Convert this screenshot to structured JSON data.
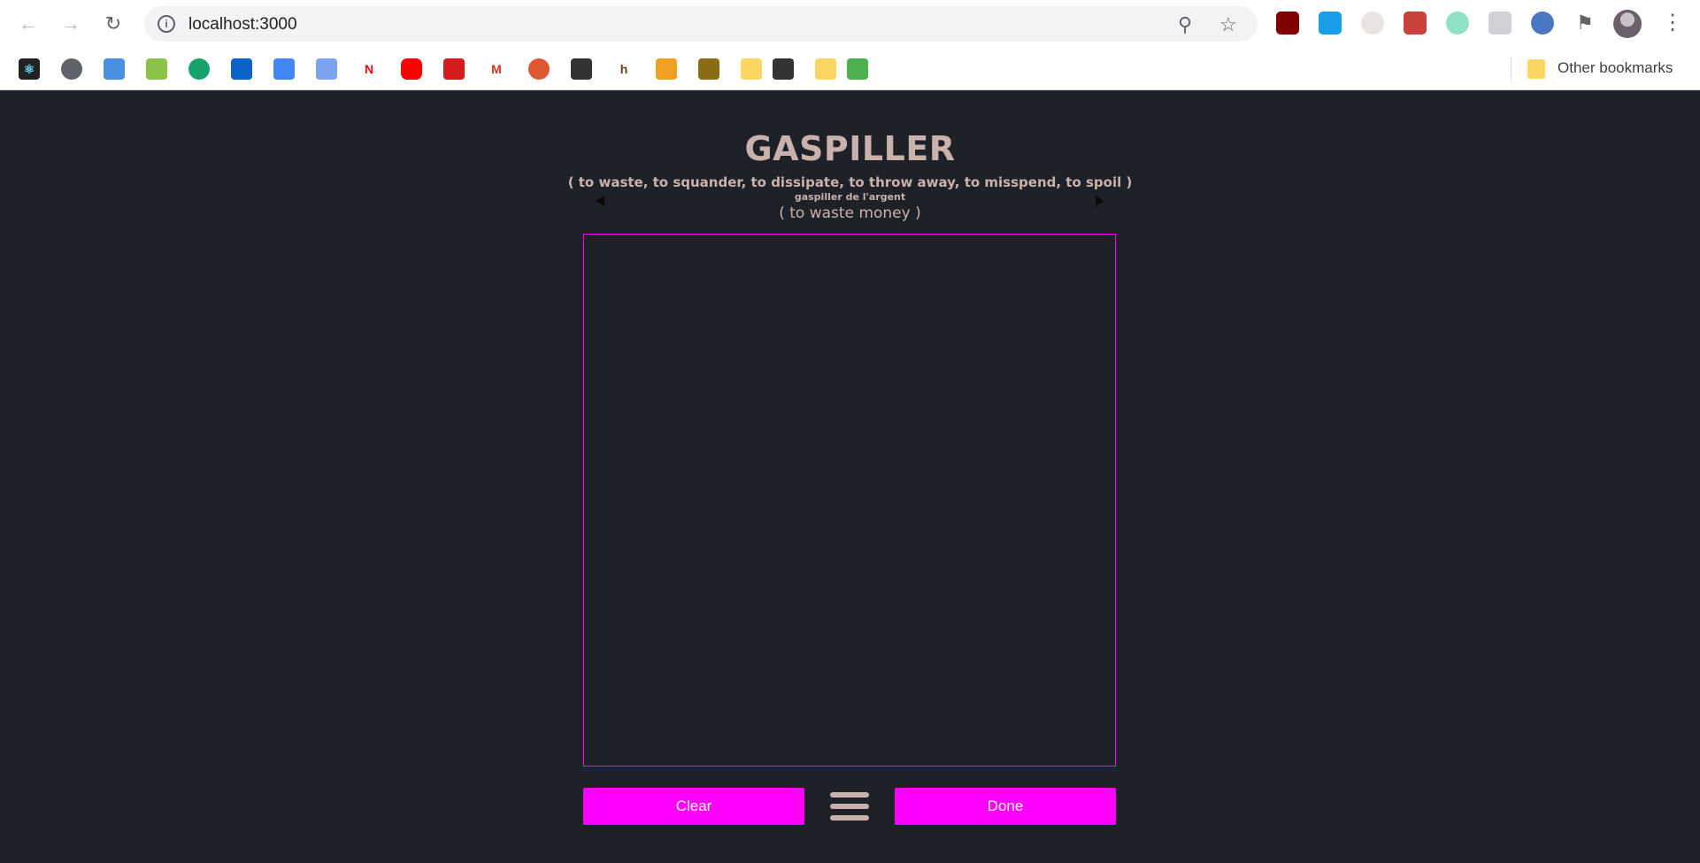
{
  "browser": {
    "url": "localhost:3000",
    "other_bookmarks": "Other bookmarks"
  },
  "colors": {
    "page_bg": "#1f2129",
    "text_accent": "#c9b1ad",
    "button_bg": "#ff00ff",
    "canvas_border": "#ff00ff"
  },
  "word": {
    "title": "GASPILLER",
    "translation": "( to waste, to squander, to dissipate, to throw away, to misspend, to spoil )",
    "example": "gaspiller de l'argent",
    "example_translation": "( to waste money )"
  },
  "actions": {
    "clear_label": "Clear",
    "done_label": "Done"
  }
}
